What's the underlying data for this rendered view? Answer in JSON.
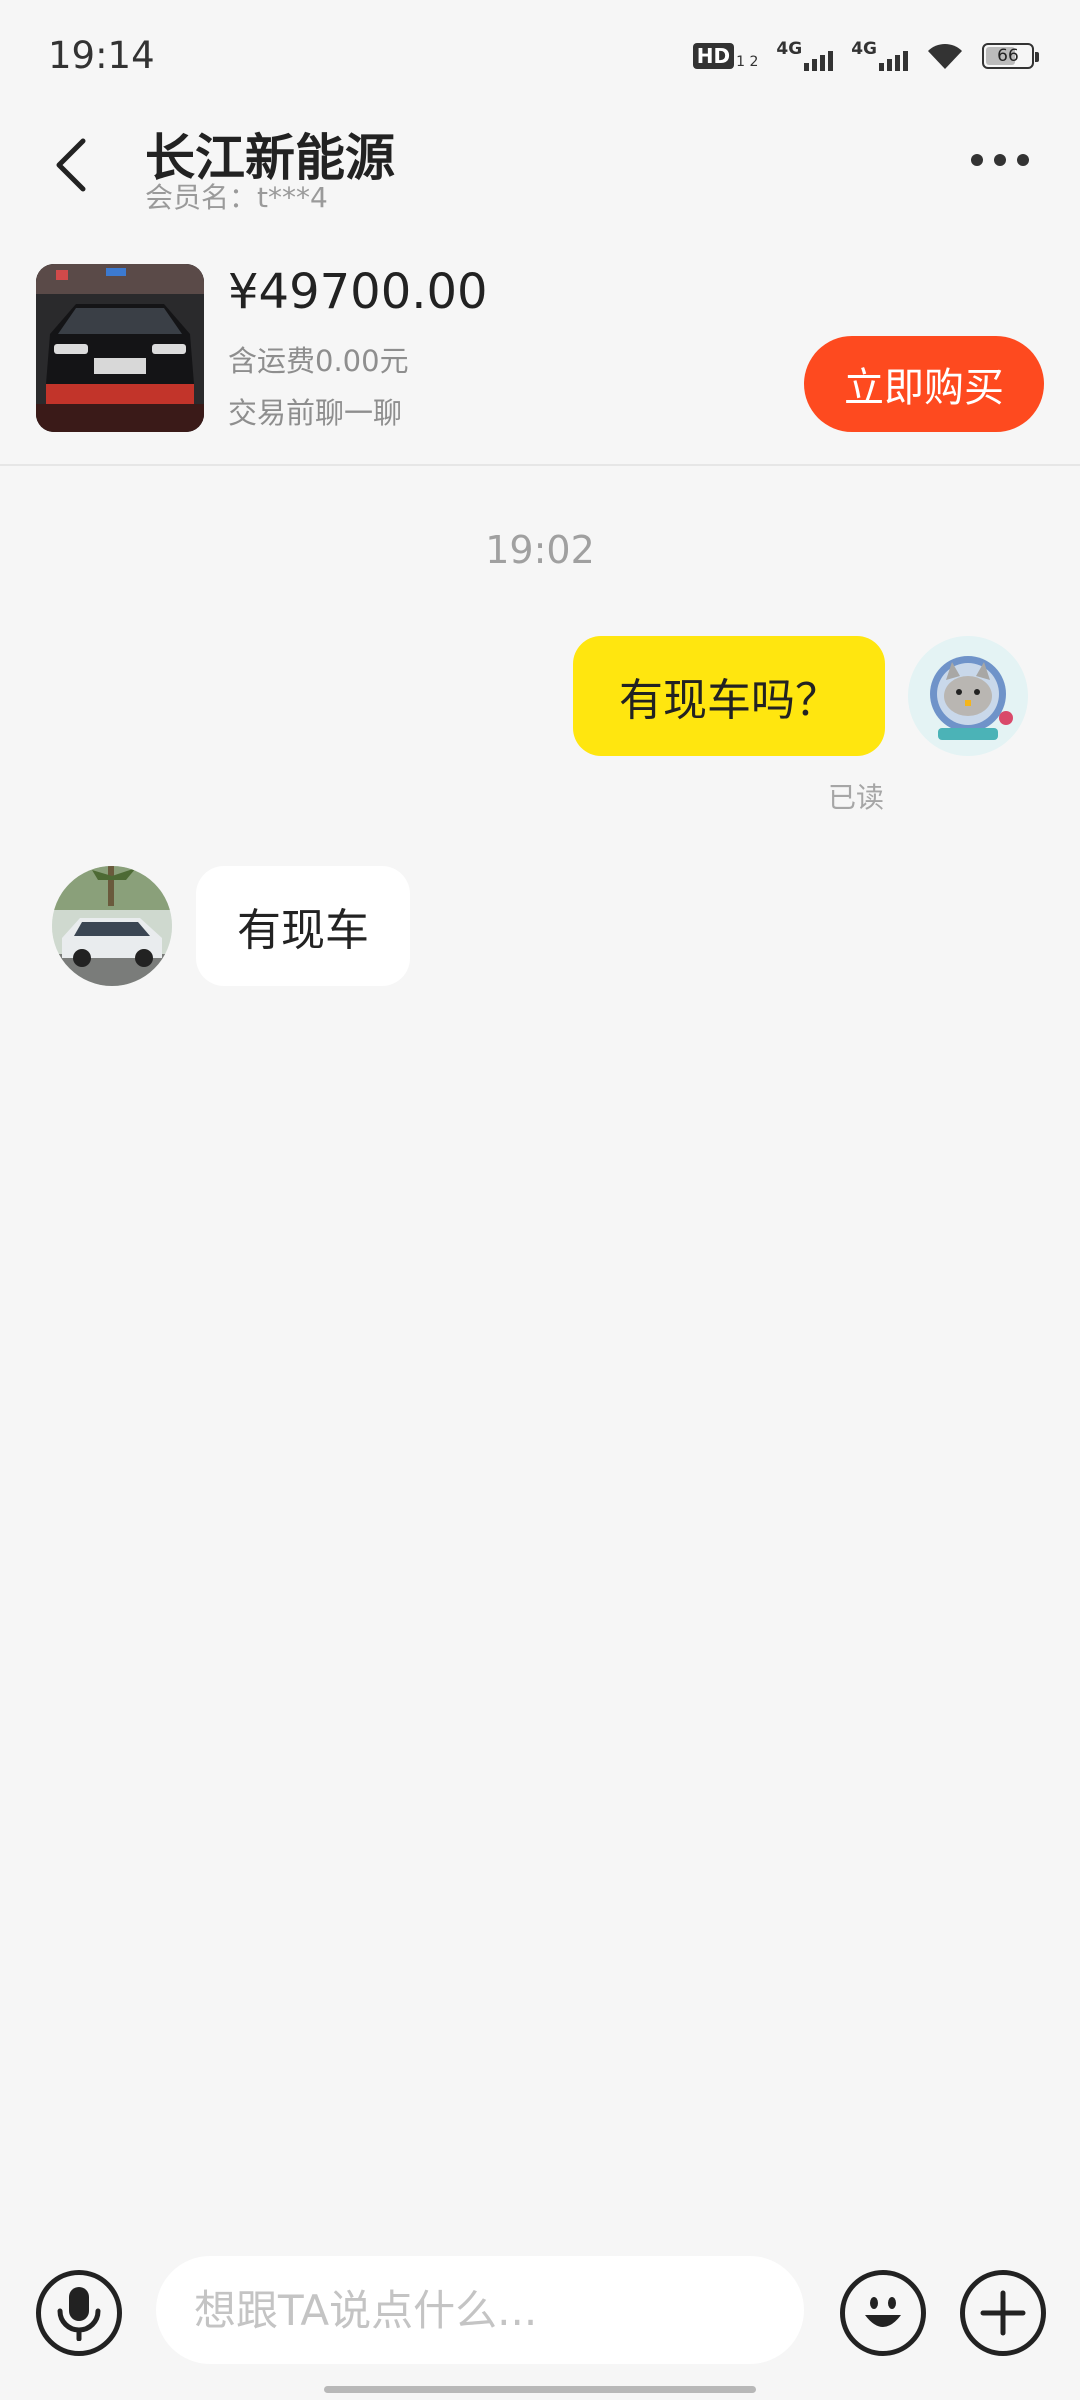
{
  "status_bar": {
    "time": "19:14",
    "hd_label": "HD",
    "hd_sub": "1 2",
    "network_1": "4G",
    "network_2": "4G",
    "battery_level": "66",
    "battery_fraction": 0.66
  },
  "header": {
    "title": "长江新能源",
    "subtitle": "会员名：t***4"
  },
  "product": {
    "price": "¥49700.00",
    "shipping": "含运费0.00元",
    "note": "交易前聊一聊",
    "buy_label": "立即购买"
  },
  "chat": {
    "time": "19:02",
    "messages": [
      {
        "direction": "outgoing",
        "text": "有现车吗？",
        "status": "已读"
      },
      {
        "direction": "incoming",
        "text": "有现车"
      }
    ]
  },
  "input_bar": {
    "placeholder": "想跟TA说点什么..."
  },
  "colors": {
    "accent_buy": "#fe4a1f",
    "outgoing_bubble": "#ffe60f",
    "incoming_bubble": "#ffffff",
    "background": "#f6f6f6"
  },
  "icons": [
    "back-arrow-icon",
    "more-dots-icon",
    "microphone-icon",
    "emoji-icon",
    "plus-icon",
    "wifi-icon",
    "battery-icon",
    "signal-icon"
  ]
}
